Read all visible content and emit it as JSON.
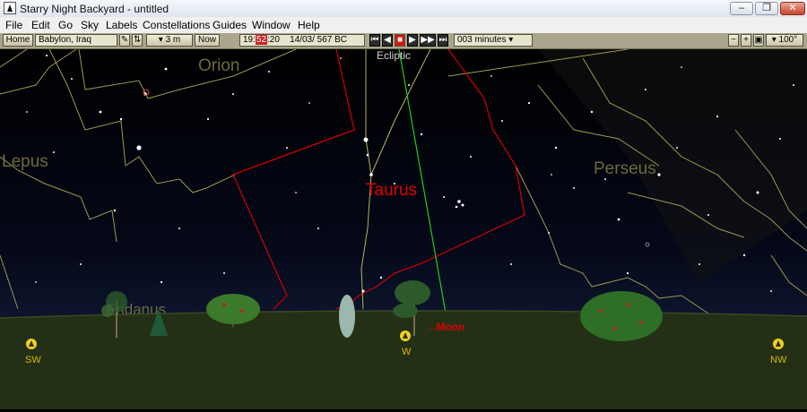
{
  "window": {
    "title": "Starry Night Backyard - untitled"
  },
  "menu": [
    "File",
    "Edit",
    "Go",
    "Sky",
    "Labels",
    "Constellations",
    "Guides",
    "Window",
    "Help"
  ],
  "toolbar": {
    "home_label": "Home",
    "location": "Babylon, Iraq",
    "elevation": "▾ 3 m",
    "now_label": "Now",
    "time_hour": "19:",
    "time_min": "52",
    "time_sec": ":20",
    "date": "14/03/  567 BC",
    "step": "003 minutes ▾",
    "fov": "▾ 100°"
  },
  "sky": {
    "constellation_labels": {
      "orion": "Orion",
      "lepus": "Lepus",
      "taurus": "Taurus",
      "perseus": "Perseus",
      "eridanus": "Eridanus"
    },
    "ecliptic_label": "Ecliptic",
    "moon_label": "→Moon",
    "compass": {
      "sw": "SW",
      "w": "W",
      "nw": "NW"
    }
  },
  "colors": {
    "taurus": "#e00000",
    "constellation_line": "#b8b45a",
    "ecliptic": "#22cc22",
    "horizon": "#243016"
  }
}
